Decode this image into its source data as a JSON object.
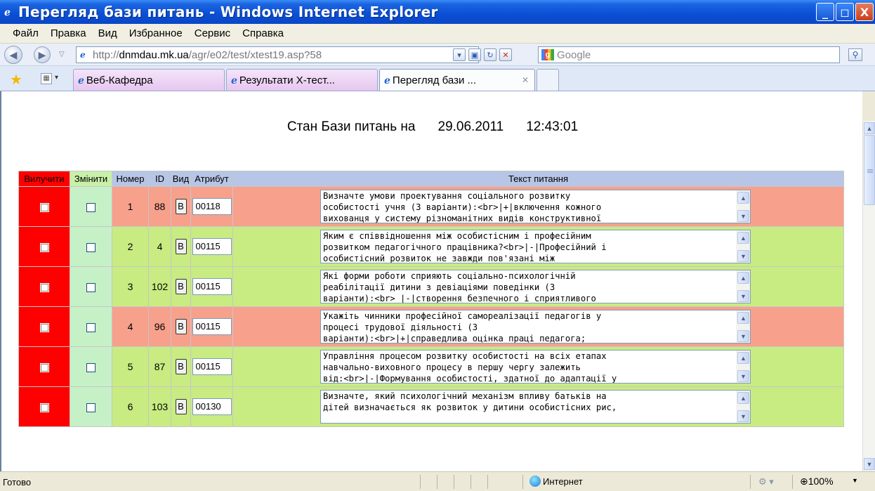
{
  "window": {
    "title": "Перегляд бази питань - Windows Internet Explorer",
    "buttons": {
      "minimize": "_",
      "maximize": "◻",
      "close": "X"
    }
  },
  "menu": [
    "Файл",
    "Правка",
    "Вид",
    "Избранное",
    "Сервис",
    "Справка"
  ],
  "address": {
    "url_prefix": "http://",
    "url_host": "dnmdau.mk.ua",
    "url_path": "/agr/e02/test/xtest19.asp?58",
    "search_placeholder": "Google"
  },
  "tabs": [
    {
      "label": "Веб-Кафедра",
      "active": false
    },
    {
      "label": "Результати Х-тест...",
      "active": false
    },
    {
      "label": "Перегляд бази ...",
      "active": true
    }
  ],
  "page": {
    "heading_label": "Стан Бази питань на",
    "date": "29.06.2011",
    "time": "12:43:01"
  },
  "table": {
    "headers": {
      "delete": "Вилучити",
      "change": "Змінити",
      "number": "Номер",
      "id": "ID",
      "view": "Вид",
      "attribute": "Атрибут",
      "text": "Текст питання"
    },
    "view_button_label": "В",
    "rows": [
      {
        "num": "1",
        "id": "88",
        "attr": "00118",
        "color": "red",
        "text": "Визначте умови проектування соціального розвитку\nособистості учня (3 варіанти):<br>|+|включення кожного\nвихованця у систему різноманітних видів конструктивної"
      },
      {
        "num": "2",
        "id": "4",
        "attr": "00115",
        "color": "green",
        "text": "Яким є співвідношення між особистісним і професійним\nрозвитком педагогічного працівника?<br>|-|Професійний і\nособистісний розвиток не завжди пов'язані між"
      },
      {
        "num": "3",
        "id": "102",
        "attr": "00115",
        "color": "green",
        "text": "Які форми роботи сприяють соціально-психологічній\nреабілітації дитини з девіаціями поведінки (3\nваріанти):<br> |-|створення безпечного і сприятливого"
      },
      {
        "num": "4",
        "id": "96",
        "attr": "00115",
        "color": "red",
        "text": "Укажіть чинники професійної самореалізації педагогів у\nпроцесі трудової діяльності (3\nваріанти):<br>|+|справедлива оцінка праці педагога;"
      },
      {
        "num": "5",
        "id": "87",
        "attr": "00115",
        "color": "green",
        "text": "Управління процесом розвитку особистості на всіх етапах\nнавчально-виховного процесу в першу чергу залежить\nвід:<br>|-|Формування особистості, здатної до адаптації у"
      },
      {
        "num": "6",
        "id": "103",
        "attr": "00130",
        "color": "green",
        "text": "Визначте, який психологічний механізм впливу батьків на\nдітей визначається як розвиток у дитини особистісних рис,\n"
      }
    ]
  },
  "status": {
    "text": "Готово",
    "zone": "Интернет",
    "zoom": "100%"
  },
  "colors": {
    "row_red": "#f7a08c",
    "row_green": "#c8eb82",
    "delete_col": "#ff0000",
    "change_col": "#c6f0c6",
    "header_bg": "#b7c5e6",
    "titlebar": "#0a4fd6"
  }
}
